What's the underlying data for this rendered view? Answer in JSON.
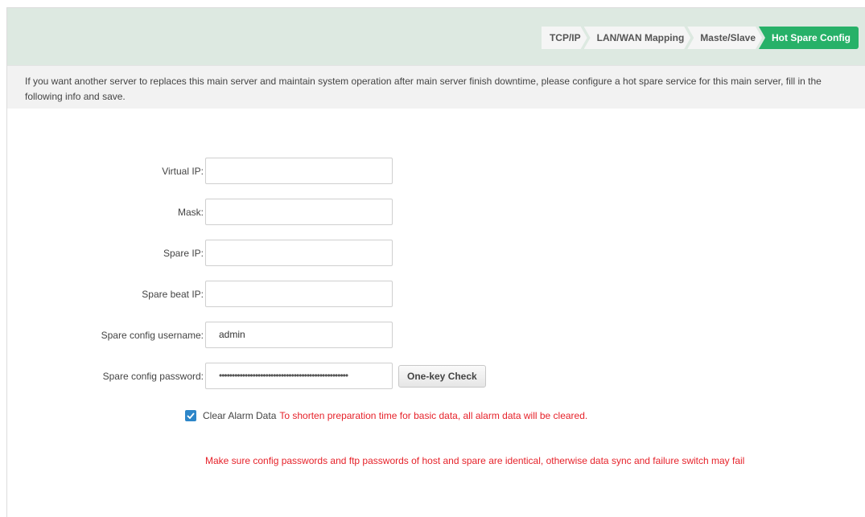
{
  "tabs": [
    {
      "label": "TCP/IP",
      "active": false
    },
    {
      "label": "LAN/WAN Mapping",
      "active": false
    },
    {
      "label": "Maste/Slave",
      "active": false
    },
    {
      "label": "Hot Spare Config",
      "active": true
    }
  ],
  "info_text": "If you want another server to replaces this main server and maintain system operation after main server finish downtime, please configure a hot spare service for this main server, fill in the following info and save.",
  "form": {
    "virtual_ip": {
      "label": "Virtual IP:",
      "value": ""
    },
    "mask": {
      "label": "Mask:",
      "value": ""
    },
    "spare_ip": {
      "label": "Spare IP:",
      "value": ""
    },
    "spare_beat_ip": {
      "label": "Spare beat IP:",
      "value": ""
    },
    "username": {
      "label": "Spare config username:",
      "value": "admin"
    },
    "password": {
      "label": "Spare config password:",
      "value": "••••••••••••••••••••••••••••••••••••••••••••••••••"
    },
    "check_button": "One-key Check"
  },
  "clear_alarm": {
    "checked": true,
    "label": "Clear Alarm Data",
    "hint": "To shorten preparation time for basic data, all alarm data will be cleared."
  },
  "warning": "Make sure config passwords and ftp passwords of host and spare are identical, otherwise data sync and failure switch may fail",
  "colors": {
    "accent": "#27b168",
    "tabbar_bg": "#dde9e1",
    "checkbox": "#2d86c9",
    "warning_red": "#e6222a"
  }
}
